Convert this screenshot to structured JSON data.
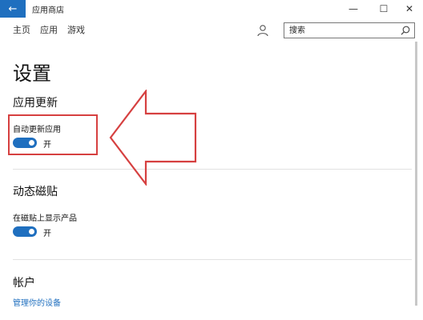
{
  "window": {
    "title": "应用商店",
    "back_glyph": "←",
    "minimize_glyph": "—",
    "maximize_glyph": "☐",
    "close_glyph": "✕"
  },
  "nav": {
    "items": [
      "主页",
      "应用",
      "游戏"
    ]
  },
  "search": {
    "placeholder": "搜索"
  },
  "page": {
    "title": "设置"
  },
  "sections": {
    "app_updates": {
      "title": "应用更新",
      "setting_label": "自动更新应用",
      "toggle_state": "开",
      "toggle_on": true
    },
    "live_tile": {
      "title": "动态磁贴",
      "setting_label": "在磁贴上显示产品",
      "toggle_state": "开",
      "toggle_on": true
    },
    "account": {
      "title": "帐户",
      "link": "管理你的设备"
    }
  },
  "colors": {
    "accent": "#1f6fbf",
    "annotation": "#d64040"
  },
  "icons": {
    "back": "back-arrow-icon",
    "user": "user-icon",
    "search": "search-icon"
  }
}
